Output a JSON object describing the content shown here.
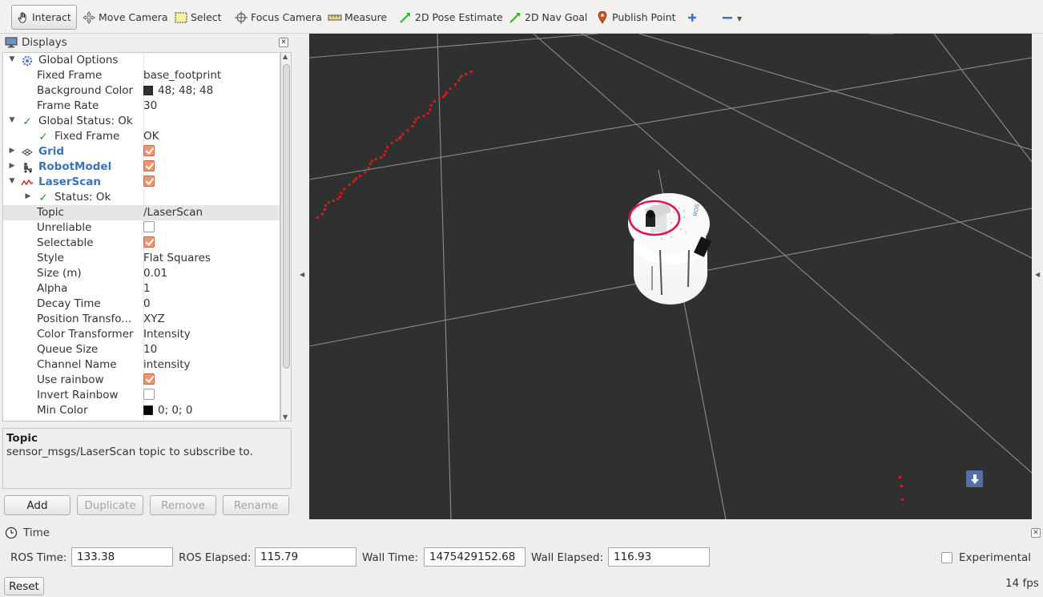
{
  "toolbar": {
    "tools": [
      {
        "label": "Interact",
        "icon": "hand-icon"
      },
      {
        "label": "Move Camera",
        "icon": "move-camera-icon"
      },
      {
        "label": "Select",
        "icon": "select-icon"
      },
      {
        "label": "Focus Camera",
        "icon": "focus-camera-icon"
      },
      {
        "label": "Measure",
        "icon": "ruler-icon"
      },
      {
        "label": "2D Pose Estimate",
        "icon": "green-arrow-icon"
      },
      {
        "label": "2D Nav Goal",
        "icon": "green-arrow-icon"
      },
      {
        "label": "Publish Point",
        "icon": "map-pin-icon"
      }
    ],
    "active": "Interact"
  },
  "displays": {
    "title": "Displays",
    "rows": [
      {
        "label": "Global Options",
        "value": ""
      },
      {
        "label": "Fixed Frame",
        "value": "base_footprint"
      },
      {
        "label": "Background Color",
        "value": "48; 48; 48",
        "color": "#303030"
      },
      {
        "label": "Frame Rate",
        "value": "30"
      },
      {
        "label": "Global Status: Ok",
        "value": ""
      },
      {
        "label": "Fixed Frame",
        "value": "OK"
      },
      {
        "label": "Grid",
        "value": ""
      },
      {
        "label": "RobotModel",
        "value": ""
      },
      {
        "label": "LaserScan",
        "value": ""
      },
      {
        "label": "Status: Ok",
        "value": ""
      },
      {
        "label": "Topic",
        "value": "/LaserScan"
      },
      {
        "label": "Unreliable",
        "value": ""
      },
      {
        "label": "Selectable",
        "value": ""
      },
      {
        "label": "Style",
        "value": "Flat Squares"
      },
      {
        "label": "Size (m)",
        "value": "0.01"
      },
      {
        "label": "Alpha",
        "value": "1"
      },
      {
        "label": "Decay Time",
        "value": "0"
      },
      {
        "label": "Position Transfo...",
        "value": "XYZ"
      },
      {
        "label": "Color Transformer",
        "value": "Intensity"
      },
      {
        "label": "Queue Size",
        "value": "10"
      },
      {
        "label": "Channel Name",
        "value": "intensity"
      },
      {
        "label": "Use rainbow",
        "value": ""
      },
      {
        "label": "Invert Rainbow",
        "value": ""
      },
      {
        "label": "Min Color",
        "value": "0; 0; 0",
        "color": "#000000"
      }
    ]
  },
  "description": {
    "title": "Topic",
    "text": "sensor_msgs/LaserScan topic to subscribe to."
  },
  "buttons": {
    "add": "Add",
    "duplicate": "Duplicate",
    "remove": "Remove",
    "rename": "Rename"
  },
  "time": {
    "title": "Time",
    "ros_time_label": "ROS Time:",
    "ros_time": "133.38",
    "ros_elapsed_label": "ROS Elapsed:",
    "ros_elapsed": "115.79",
    "wall_time_label": "Wall Time:",
    "wall_time": "1475429152.68",
    "wall_elapsed_label": "Wall Elapsed:",
    "wall_elapsed": "116.93",
    "experimental_label": "Experimental",
    "reset": "Reset",
    "fps": "14 fps"
  },
  "colors": {
    "viewport_bg": "#303030",
    "laser_points": "#dd1a1a",
    "highlight_ring": "#e0125a",
    "checkbox_on": "#f09570"
  }
}
